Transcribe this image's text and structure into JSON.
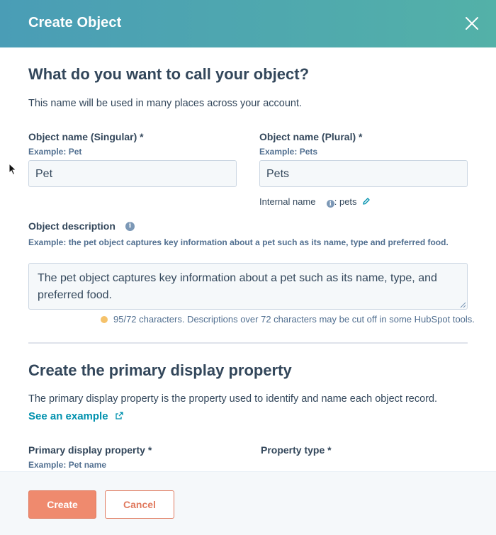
{
  "modal": {
    "title": "Create Object",
    "close_icon": "close-icon"
  },
  "naming": {
    "heading": "What do you want to call your object?",
    "description": "This name will be used in many places across your account.",
    "singular": {
      "label": "Object name (Singular) *",
      "hint": "Example: Pet",
      "value": "Pet"
    },
    "plural": {
      "label": "Object name (Plural) *",
      "hint": "Example: Pets",
      "value": "Pets"
    },
    "internal_name": {
      "label": "Internal name",
      "value": ": pets",
      "info_icon": "info-icon",
      "edit_icon": "pencil-icon"
    },
    "object_description": {
      "label": "Object description",
      "info_icon": "info-icon",
      "hint": "Example: the pet object captures key information about a pet such as its name, type and preferred food.",
      "value": "The pet object captures key information about a pet such as its name, type, and preferred food.",
      "char_count": "95/72 characters. Descriptions over 72 characters may be cut off in some HubSpot tools.",
      "warning_color": "#f5c26b"
    }
  },
  "display_property": {
    "heading": "Create the primary display property",
    "description": "The primary display property is the property used to identify and name each object record.",
    "link_label": "See an example",
    "link_icon": "external-link-icon",
    "primary_label": "Primary display property *",
    "primary_hint": "Example: Pet name",
    "type_label": "Property type *"
  },
  "footer": {
    "create_label": "Create",
    "cancel_label": "Cancel"
  },
  "colors": {
    "header_gradient_start": "#4a9db6",
    "header_gradient_end": "#53b1a8",
    "primary_button": "#ef8a6e",
    "link": "#0091ae",
    "text": "#33475b"
  }
}
